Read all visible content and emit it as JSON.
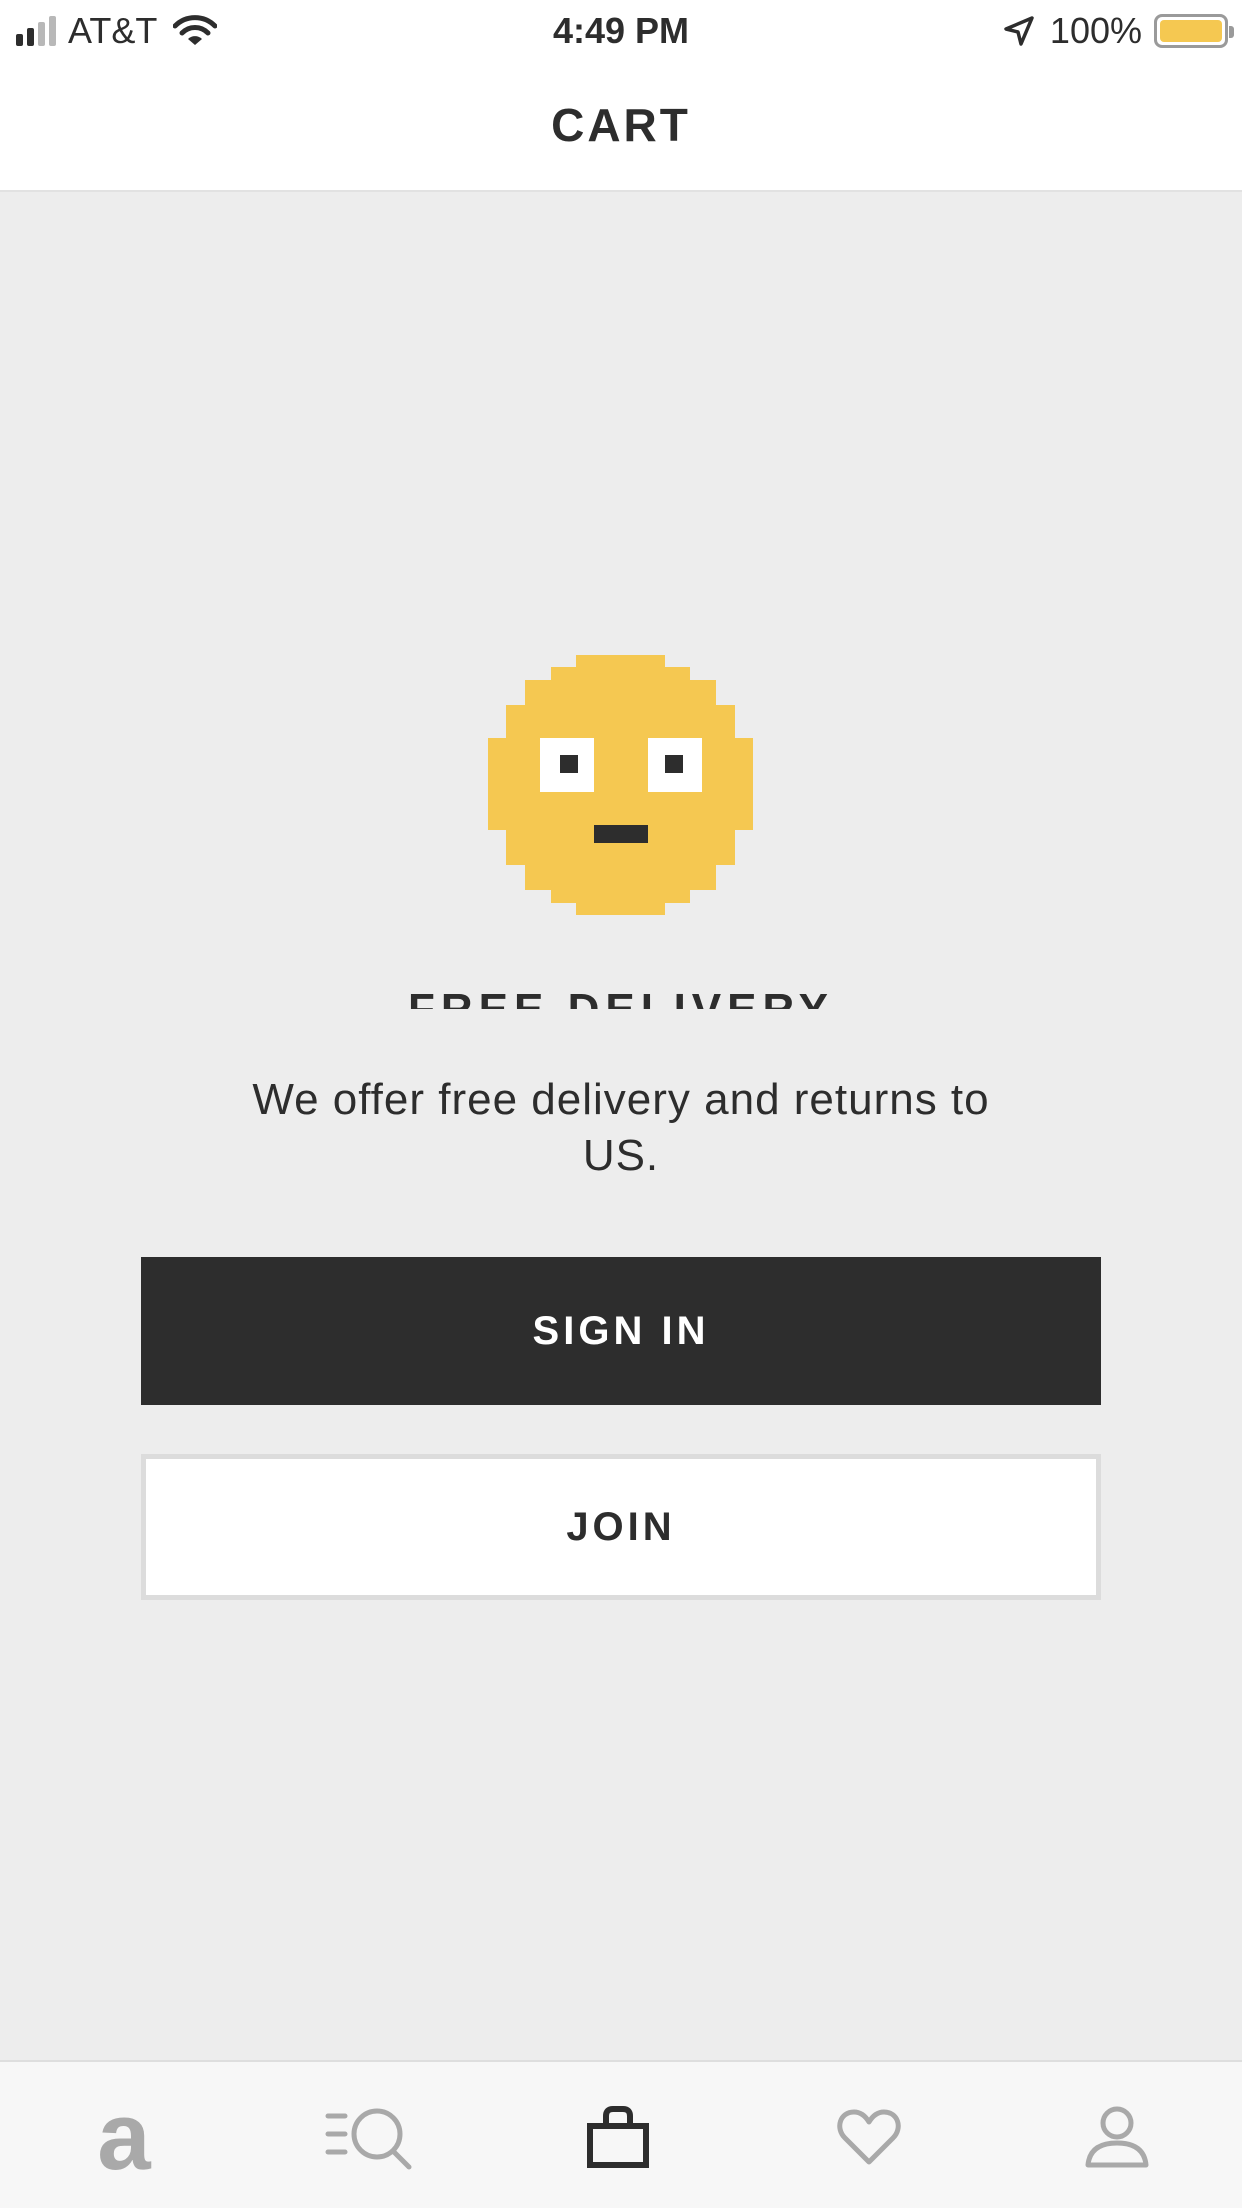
{
  "status_bar": {
    "carrier": "AT&T",
    "time": "4:49 PM",
    "battery_percent": "100%",
    "battery_color": "#f5c851",
    "signal_bars_filled": 2,
    "signal_bars_total": 4
  },
  "header": {
    "title": "CART"
  },
  "empty_state": {
    "icon": "pixel-face-icon",
    "heading": "FREE DELIVERY",
    "message": "We offer free delivery and returns to US."
  },
  "actions": {
    "sign_in_label": "SIGN IN",
    "join_label": "JOIN"
  },
  "tab_bar": {
    "home_logo": "a",
    "active_tab": "bag",
    "items": [
      {
        "name": "home",
        "icon": "asos-logo-icon"
      },
      {
        "name": "search",
        "icon": "search-icon"
      },
      {
        "name": "bag",
        "icon": "bag-icon"
      },
      {
        "name": "saved",
        "icon": "heart-icon"
      },
      {
        "name": "account",
        "icon": "user-icon"
      }
    ]
  },
  "colors": {
    "accent_yellow": "#f5c851",
    "dark": "#2d2d2d",
    "background": "#ededed"
  }
}
